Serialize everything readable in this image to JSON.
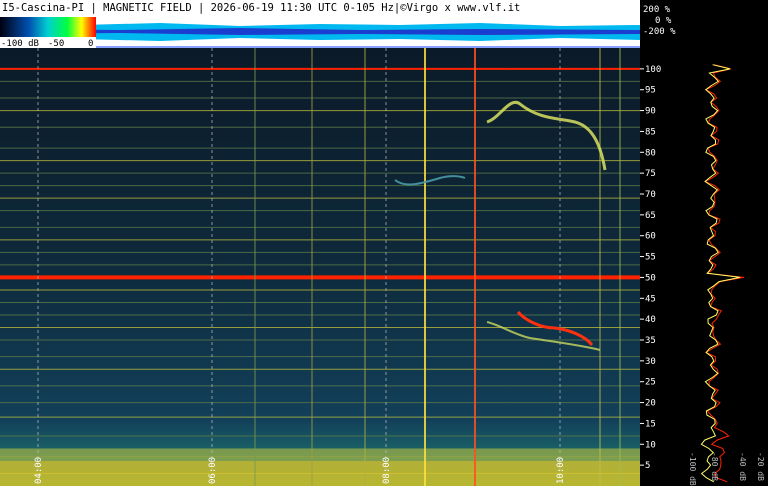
{
  "header": {
    "text": "I5-Cascina-PI | MAGNETIC FIELD | 2026-06-19 11:30 UTC 0-105 Hz|©Virgo x www.vlf.it"
  },
  "scale": {
    "labels": [
      "-100 dB",
      "-50",
      "0"
    ]
  },
  "amplitude": {
    "labels": [
      "200 %",
      "0 %",
      "-200 %"
    ]
  },
  "colors": {
    "background": "#0a1a2a",
    "accent": "#ff2200",
    "trace": "#ffff66",
    "header_bg": "#ffffff",
    "cyan": "#00c8ff",
    "blue": "#0033cc"
  },
  "chart_data": {
    "type": "heatmap",
    "title": "I5-Cascina-PI | MAGNETIC FIELD | 2026-06-19 11:30 UTC 0-105 Hz|©Virgo x www.vlf.it",
    "x_tick_labels": [
      "04:00",
      "06:00",
      "08:00",
      "10:00"
    ],
    "y_tick_labels": [
      "5",
      "10",
      "15",
      "20",
      "25",
      "30",
      "35",
      "40",
      "45",
      "50",
      "55",
      "60",
      "65",
      "70",
      "75",
      "80",
      "85",
      "90",
      "95",
      "100"
    ],
    "yaxis_unit": "Hz",
    "ylim": [
      0,
      105
    ],
    "colorbar": {
      "min": -100,
      "max": 0,
      "unit": "dB"
    },
    "strong_lines_hz": [
      50,
      100
    ],
    "side_spectrum": {
      "x_tick_labels": [
        "-100 dB",
        "-80 dB",
        "-40 dB",
        "-20 dB"
      ]
    }
  }
}
